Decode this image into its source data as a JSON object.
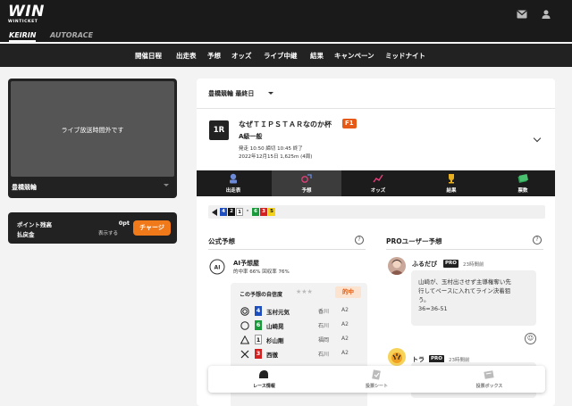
{
  "header": {
    "logo_main": "WIN",
    "logo_sub": "WINTICKET",
    "icons": [
      "mail-icon",
      "user-icon"
    ]
  },
  "sport_tabs": [
    {
      "label": "KEIRIN",
      "active": true
    },
    {
      "label": "AUTORACE",
      "active": false
    }
  ],
  "nav": [
    "開催日程",
    "出走表",
    "予想",
    "オッズ",
    "ライブ中継",
    "結果",
    "キャンペーン",
    "ミッドナイト"
  ],
  "live": {
    "message": "ライブ放送時間外です",
    "venue": "豊橋競輪"
  },
  "points": {
    "balance_label": "ポイント残高",
    "balance_value": "0pt",
    "payout_label": "払戻金",
    "payout_value": "表示する",
    "charge_button": "チャージ"
  },
  "venue_select": "豊橋競輪 最終日",
  "race": {
    "number": "1R",
    "name": "なぜＴＩＰＳＴＡＲなのか杯",
    "grade": "F1",
    "class": "A級一般",
    "times": "発走 10:50 締切 10:45 終了",
    "date_info": "2022年12月15日 1,625m (4周)"
  },
  "tabs": [
    {
      "label": "出走表",
      "icon": "race-card-icon",
      "active": false
    },
    {
      "label": "予想",
      "icon": "prediction-icon",
      "active": true
    },
    {
      "label": "オッズ",
      "icon": "odds-chart-icon",
      "active": false
    },
    {
      "label": "結果",
      "icon": "trophy-icon",
      "active": false
    },
    {
      "label": "票数",
      "icon": "ticket-stack-icon",
      "active": false
    }
  ],
  "line_order": [
    {
      "num": "4",
      "bg": "#1f4fbf",
      "fg": "#ffffff"
    },
    {
      "num": "2",
      "bg": "#111111",
      "fg": "#ffffff"
    },
    {
      "num": "1",
      "bg": "#ffffff",
      "fg": "#111111"
    },
    {
      "num": "・",
      "bg": "transparent",
      "fg": "#111111"
    },
    {
      "num": "6",
      "bg": "#1a9a3a",
      "fg": "#ffffff"
    },
    {
      "num": "3",
      "bg": "#d32020",
      "fg": "#ffffff"
    },
    {
      "num": "5",
      "bg": "#f2d21a",
      "fg": "#111111"
    }
  ],
  "official": {
    "title": "公式予想",
    "ai_name": "AI予想屋",
    "ai_stats": "的中率 66%  回収率 76%",
    "confidence_label": "この予想の自信度",
    "stars": "★★★",
    "hit_label": "的中",
    "picks": [
      {
        "mark": "double-circle",
        "num": "4",
        "bg": "#1f4fbf",
        "fg": "#ffffff",
        "name": "玉村元気",
        "pref": "香川",
        "class": "A2"
      },
      {
        "mark": "circle",
        "num": "6",
        "bg": "#1a9a3a",
        "fg": "#ffffff",
        "name": "山崎晃",
        "pref": "石川",
        "class": "A2"
      },
      {
        "mark": "triangle",
        "num": "1",
        "bg": "#ffffff",
        "fg": "#111111",
        "name": "杉山剛",
        "pref": "福岡",
        "class": "A2"
      },
      {
        "mark": "cross",
        "num": "3",
        "bg": "#d32020",
        "fg": "#ffffff",
        "name": "西徹",
        "pref": "石川",
        "class": "A2"
      }
    ]
  },
  "pro": {
    "title": "PROユーザー予想",
    "users": [
      {
        "name": "ふるだび",
        "badge": "PRO",
        "time": "23時間前"
      },
      {
        "name": "トラ",
        "badge": "PRO",
        "time": "23時間前"
      }
    ],
    "comment_lines": [
      "山崎が、玉村出させず主導権奪い先",
      "行してペースに入れてライン決着狙",
      "う。",
      "36=36-51"
    ],
    "faded_line": "..."
  },
  "bottom_bar": [
    {
      "label": "レース情報",
      "icon": "helmet-icon"
    },
    {
      "label": "投票シート",
      "icon": "ballot-icon"
    },
    {
      "label": "投票ボックス",
      "icon": "ticket-box-icon"
    }
  ]
}
